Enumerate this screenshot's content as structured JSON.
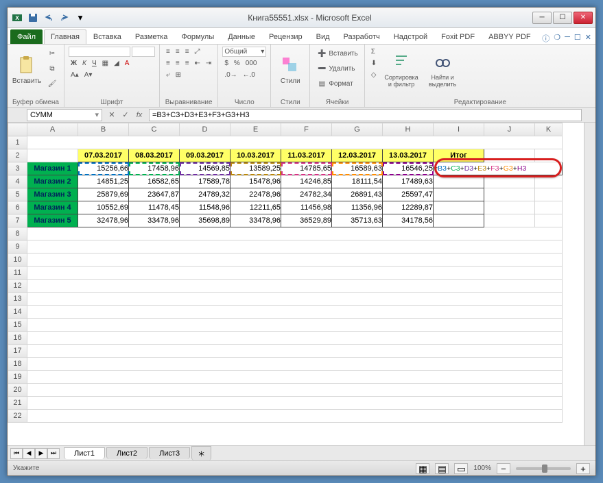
{
  "window": {
    "title": "Книга55551.xlsx - Microsoft Excel"
  },
  "ribbon": {
    "file": "Файл",
    "tabs": [
      "Главная",
      "Вставка",
      "Разметка",
      "Формулы",
      "Данные",
      "Рецензир",
      "Вид",
      "Разработч",
      "Надстрой",
      "Foxit PDF",
      "ABBYY PDF"
    ],
    "active_tab": 0,
    "groups": {
      "clipboard": {
        "label": "Буфер обмена",
        "paste": "Вставить"
      },
      "font": {
        "label": "Шрифт",
        "bold": "Ж",
        "italic": "К",
        "underline": "Ч"
      },
      "alignment": {
        "label": "Выравнивание"
      },
      "number": {
        "label": "Число",
        "format": "Общий"
      },
      "styles": {
        "label": "Стили",
        "btn": "Стили"
      },
      "cells": {
        "label": "Ячейки",
        "insert": "Вставить",
        "delete": "Удалить",
        "format": "Формат"
      },
      "editing": {
        "label": "Редактирование",
        "sort": "Сортировка и фильтр",
        "find": "Найти и выделить"
      }
    }
  },
  "namebox": "СУММ",
  "formula": "=B3+C3+D3+E3+F3+G3+H3",
  "sheet": {
    "columns": [
      "A",
      "B",
      "C",
      "D",
      "E",
      "F",
      "G",
      "H",
      "I",
      "J",
      "K"
    ],
    "headers": [
      "07.03.2017",
      "08.03.2017",
      "09.03.2017",
      "10.03.2017",
      "11.03.2017",
      "12.03.2017",
      "13.03.2017",
      "Итог"
    ],
    "rows": [
      {
        "label": "Магазин 1",
        "values": [
          "15256,66",
          "17458,96",
          "14569,85",
          "13589,25",
          "14785,65",
          "16589,63",
          "16546,25"
        ],
        "formula": "=B3+C3+D3+E3+F3+G3+H3"
      },
      {
        "label": "Магазин 2",
        "values": [
          "14851,25",
          "16582,65",
          "17589,78",
          "15478,96",
          "14246,85",
          "18111,54",
          "17489,63"
        ]
      },
      {
        "label": "Магазин 3",
        "values": [
          "25879,69",
          "23647,87",
          "24789,32",
          "22478,96",
          "24782,34",
          "26891,43",
          "25597,47"
        ]
      },
      {
        "label": "Магазин 4",
        "values": [
          "10552,69",
          "11478,45",
          "11548,96",
          "12211,65",
          "11456,98",
          "11356,96",
          "12289,87"
        ]
      },
      {
        "label": "Магазин 5",
        "values": [
          "32478,96",
          "33478,96",
          "35698,89",
          "33478,96",
          "36529,89",
          "35713,63",
          "34178,56"
        ]
      }
    ],
    "formula_parts": [
      {
        "t": "=",
        "c": "#000"
      },
      {
        "t": "B3",
        "c": "#0070c0"
      },
      {
        "t": "+",
        "c": "#000"
      },
      {
        "t": "C3",
        "c": "#00b050"
      },
      {
        "t": "+",
        "c": "#000"
      },
      {
        "t": "D3",
        "c": "#7030a0"
      },
      {
        "t": "+",
        "c": "#000"
      },
      {
        "t": "E3",
        "c": "#b8860b"
      },
      {
        "t": "+",
        "c": "#000"
      },
      {
        "t": "F3",
        "c": "#d63384"
      },
      {
        "t": "+",
        "c": "#000"
      },
      {
        "t": "G3",
        "c": "#ff8c00"
      },
      {
        "t": "+",
        "c": "#000"
      },
      {
        "t": "H3",
        "c": "#8b008b"
      }
    ]
  },
  "sheet_tabs": [
    "Лист1",
    "Лист2",
    "Лист3"
  ],
  "status": {
    "mode": "Укажите",
    "zoom": "100%"
  }
}
